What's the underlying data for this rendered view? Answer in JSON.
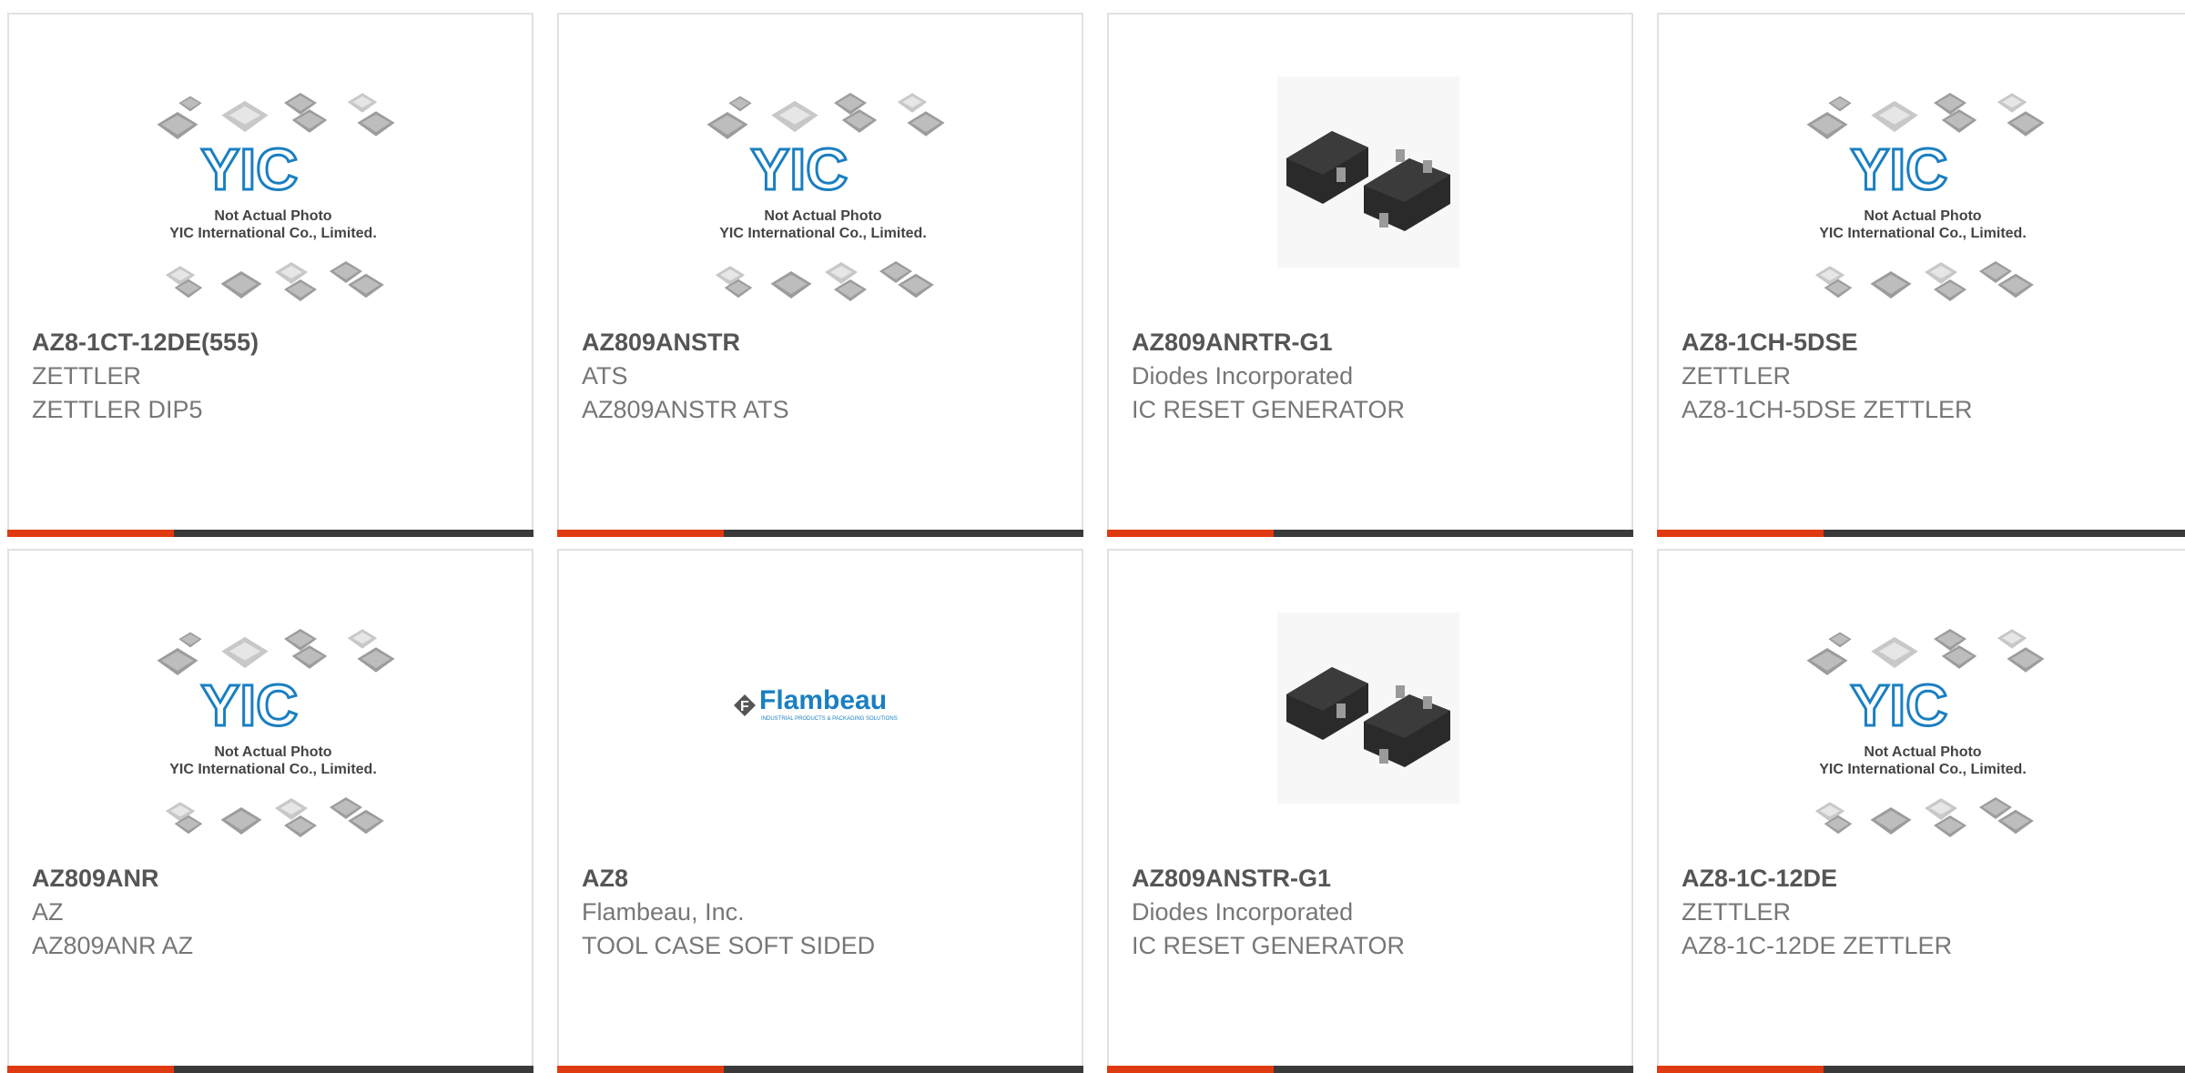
{
  "placeholder_image": {
    "line1": "Not Actual Photo",
    "line2": "YIC International Co., Limited.",
    "brand_mark": "YIC"
  },
  "logo_text": {
    "name": "Flambeau",
    "tagline": "INDUSTRIAL PRODUCTS & PACKAGING SOLUTIONS"
  },
  "colors": {
    "accent": "#e03a10",
    "bar": "#3a3a3a",
    "border": "#e1e1e1",
    "yic_blue": "#1a7fc1"
  },
  "products": [
    {
      "part_number": "AZ8-1CT-12DE(555)",
      "manufacturer": "ZETTLER",
      "description": "ZETTLER DIP5",
      "image": "yic-placeholder"
    },
    {
      "part_number": "AZ809ANSTR",
      "manufacturer": "ATS",
      "description": "AZ809ANSTR ATS",
      "image": "yic-placeholder"
    },
    {
      "part_number": "AZ809ANRTR-G1",
      "manufacturer": "Diodes Incorporated",
      "description": "IC RESET GENERATOR",
      "image": "sot23-photo"
    },
    {
      "part_number": "AZ8-1CH-5DSE",
      "manufacturer": "ZETTLER",
      "description": "AZ8-1CH-5DSE ZETTLER",
      "image": "yic-placeholder"
    },
    {
      "part_number": "AZ809ANR",
      "manufacturer": "AZ",
      "description": "AZ809ANR AZ",
      "image": "yic-placeholder"
    },
    {
      "part_number": "AZ8",
      "manufacturer": "Flambeau, Inc.",
      "description": "TOOL CASE SOFT SIDED",
      "image": "flambeau-logo"
    },
    {
      "part_number": "AZ809ANSTR-G1",
      "manufacturer": "Diodes Incorporated",
      "description": "IC RESET GENERATOR",
      "image": "sot23-photo"
    },
    {
      "part_number": "AZ8-1C-12DE",
      "manufacturer": "ZETTLER",
      "description": "AZ8-1C-12DE ZETTLER",
      "image": "yic-placeholder"
    }
  ]
}
